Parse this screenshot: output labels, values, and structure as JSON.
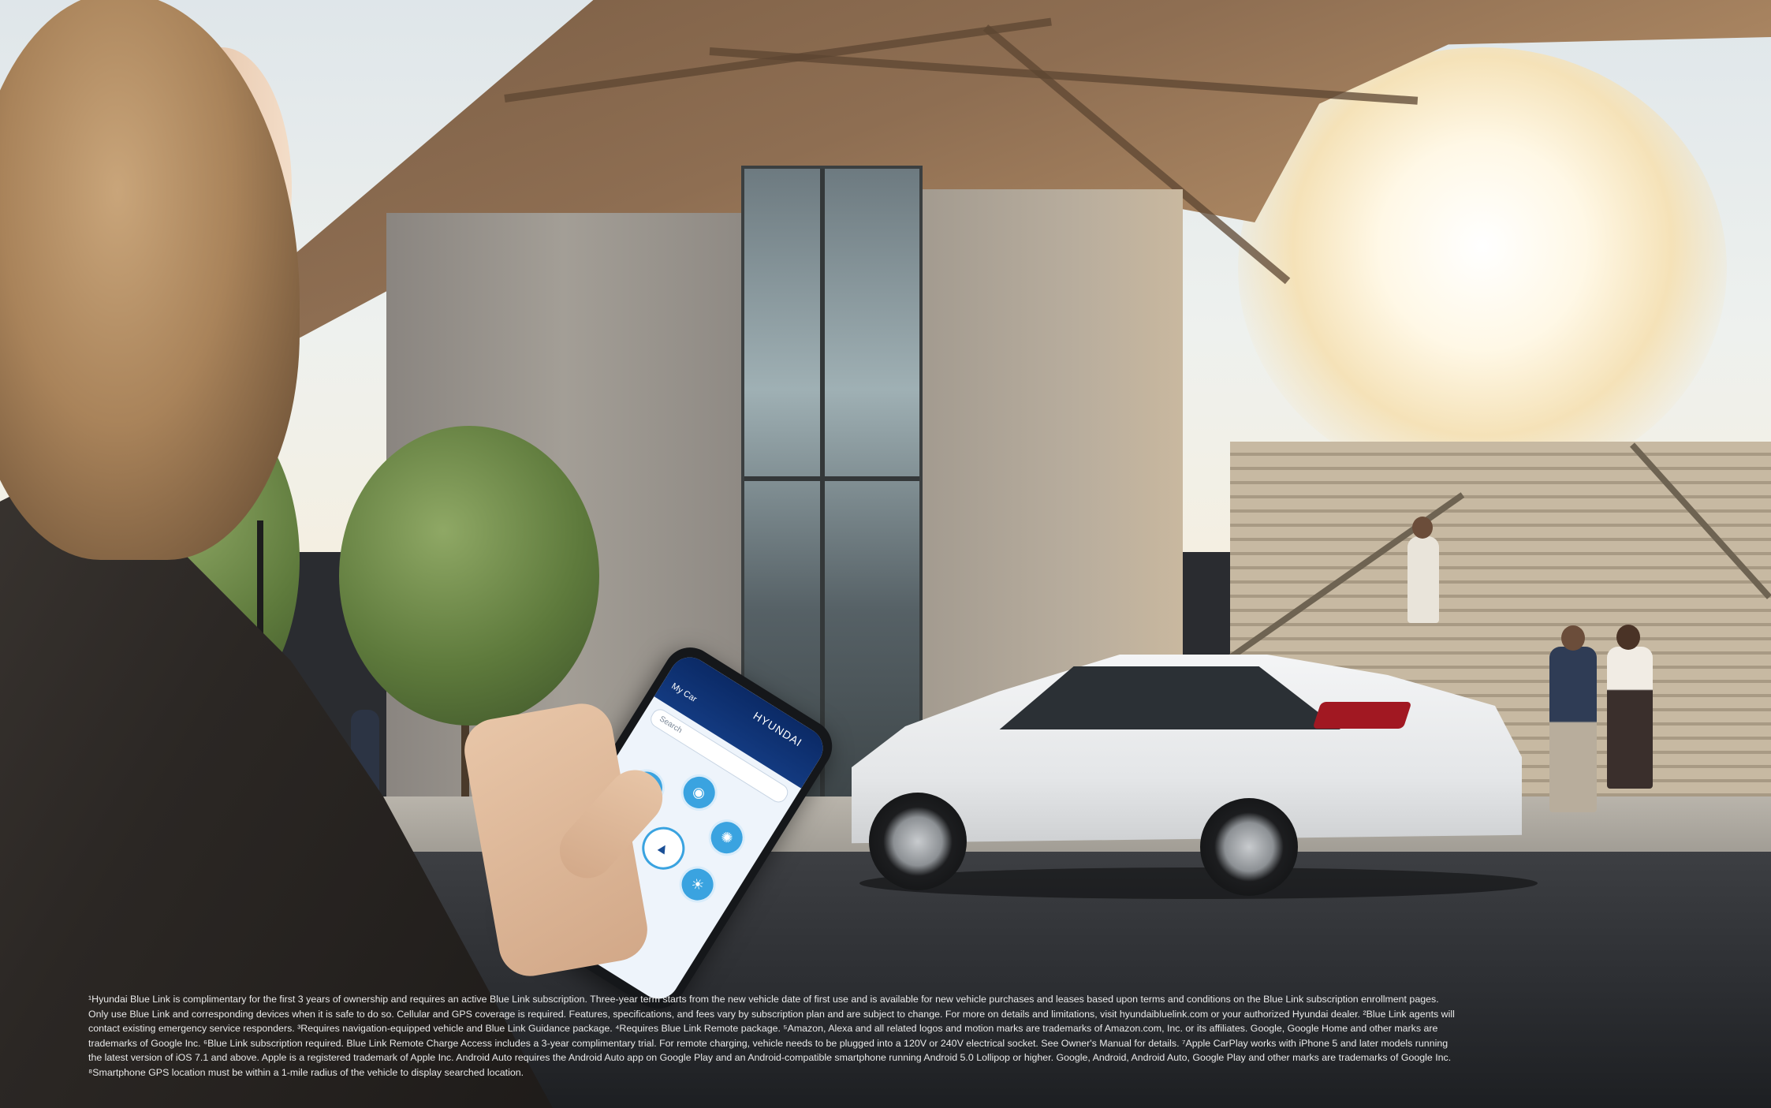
{
  "phone_app": {
    "brand": "HYUNDAI",
    "vehicle_tab": "My Car",
    "search_placeholder": "Search"
  },
  "disclaimer": {
    "lines": [
      "¹Hyundai Blue Link is complimentary for the first 3 years of ownership and requires an active Blue Link subscription. Three-year term starts from the new vehicle date of first use and is available for new vehicle purchases and leases based upon terms and conditions on the Blue Link subscription enrollment pages.",
      "Only use Blue Link and corresponding devices when it is safe to do so. Cellular and GPS coverage is required. Features, specifications, and fees vary by subscription plan and are subject to change. For more on details and limitations, visit hyundaibluelink.com or your authorized Hyundai dealer. ²Blue Link agents will",
      "contact existing emergency service responders. ³Requires navigation-equipped vehicle and Blue Link Guidance package. ⁴Requires Blue Link Remote package. ⁵Amazon, Alexa and all related logos and motion marks are trademarks of Amazon.com, Inc. or its affiliates. Google, Google Home and other marks are",
      "trademarks of Google Inc. ⁶Blue Link subscription required. Blue Link Remote Charge Access includes a 3-year complimentary trial. For remote charging, vehicle needs to be plugged into a 120V or 240V electrical socket. See Owner's Manual for details. ⁷Apple CarPlay works with iPhone 5 and later models running",
      "the latest version of iOS 7.1 and above. Apple is a registered trademark of Apple Inc. Android Auto requires the Android Auto app on Google Play and an Android-compatible smartphone running Android 5.0 Lollipop or higher. Google, Android, Android Auto, Google Play and other marks are trademarks of Google Inc.",
      "⁸Smartphone GPS location must be within a 1-mile radius of the vehicle to display searched location."
    ]
  },
  "colors": {
    "app_header": "#0b2a66",
    "app_accent": "#3aa3e0",
    "taillight": "#a11822"
  }
}
